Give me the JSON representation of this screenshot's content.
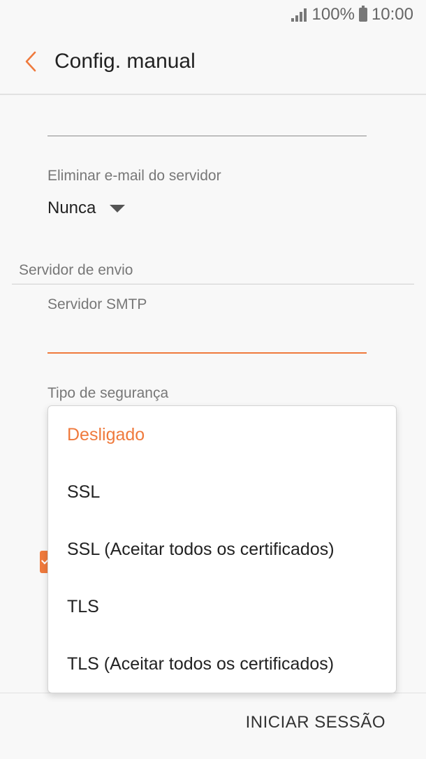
{
  "status_bar": {
    "battery_percent": "100%",
    "time": "10:00"
  },
  "header": {
    "title": "Config. manual"
  },
  "delete_email": {
    "label": "Eliminar e-mail do servidor",
    "value": "Nunca"
  },
  "outgoing_section": {
    "title": "Servidor de envio",
    "smtp_label": "Servidor SMTP",
    "smtp_value": "",
    "security_label": "Tipo de segurança"
  },
  "security_dropdown": {
    "options": [
      "Desligado",
      "SSL",
      "SSL (Aceitar todos os certificados)",
      "TLS",
      "TLS (Aceitar todos os certificados)"
    ],
    "selected": "Desligado"
  },
  "footer": {
    "login_label": "INICIAR SESSÃO"
  },
  "colors": {
    "accent": "#ef7a3d",
    "background": "#f8f8f8"
  },
  "icons": {
    "back": "chevron-left-icon",
    "signal": "signal-icon",
    "battery": "battery-icon",
    "dropdown": "triangle-down-icon"
  }
}
